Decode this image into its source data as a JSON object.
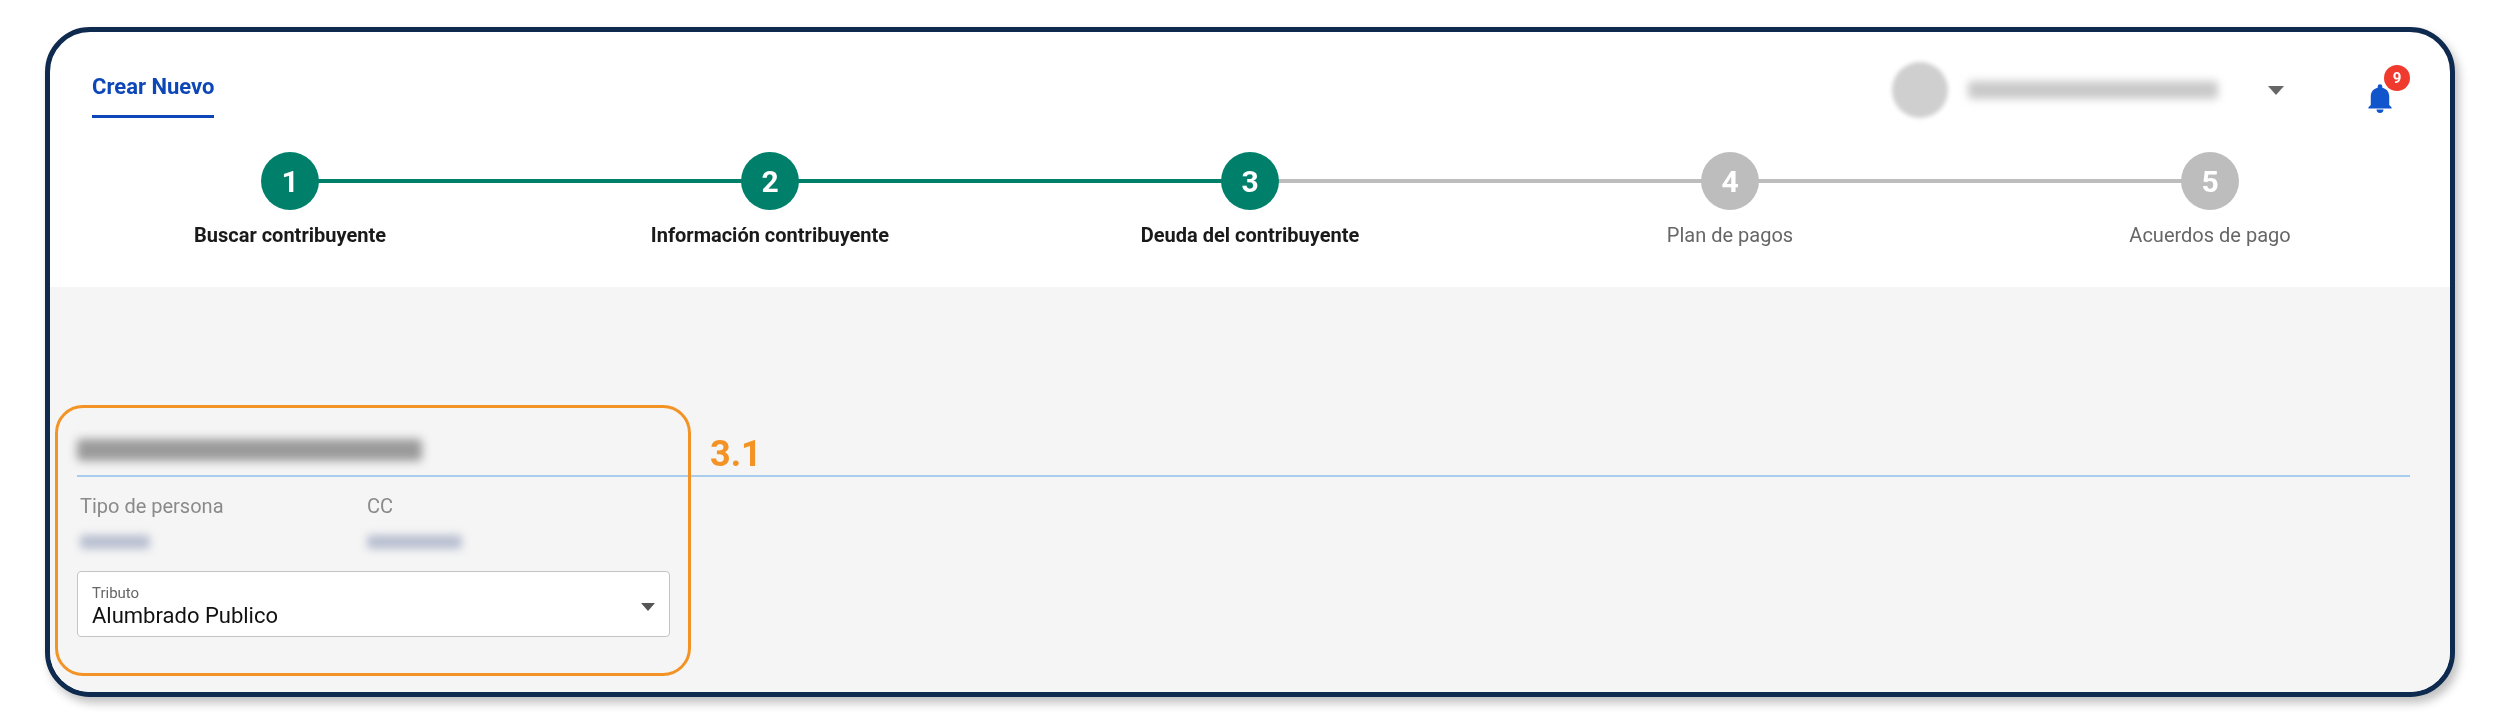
{
  "tabs": [
    {
      "label": "Crear Nuevo",
      "selected": true
    }
  ],
  "notifications": {
    "badge": "9"
  },
  "steps": [
    {
      "number": "1",
      "label": "Buscar contribuyente",
      "reached": true
    },
    {
      "number": "2",
      "label": "Información contribuyente",
      "reached": true
    },
    {
      "number": "3",
      "label": "Deuda del contribuyente",
      "reached": true
    },
    {
      "number": "4",
      "label": "Plan de pagos",
      "reached": false
    },
    {
      "number": "5",
      "label": "Acuerdos de pago",
      "reached": false
    }
  ],
  "taxpayer": {
    "fields": [
      {
        "label": "Tipo de persona"
      },
      {
        "label": "CC"
      }
    ],
    "select": {
      "label": "Tributo",
      "value": "Alumbrado Publico"
    }
  },
  "annotation": {
    "label": "3.1"
  }
}
